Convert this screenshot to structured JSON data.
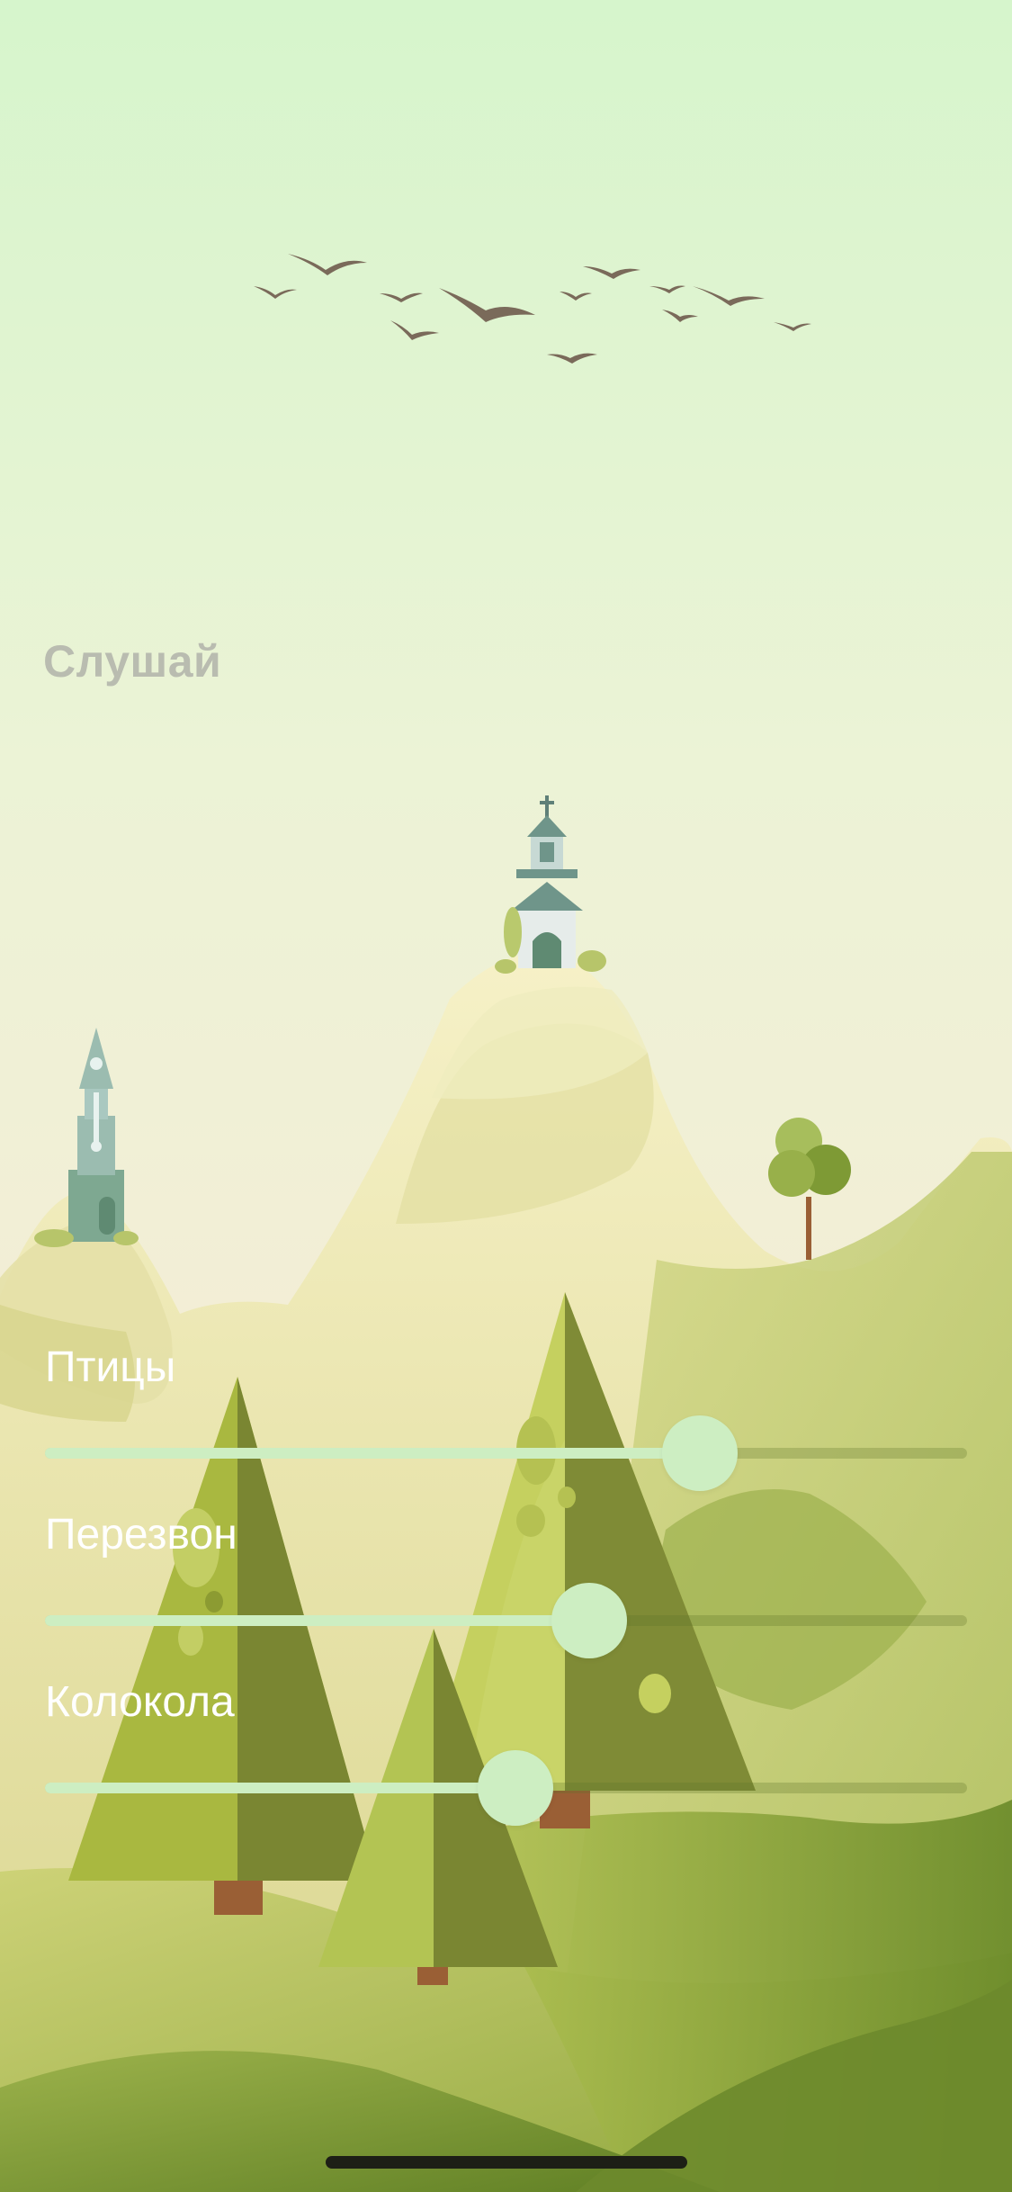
{
  "screen": {
    "title": "Слушай"
  },
  "sounds": [
    {
      "label": "Птицы",
      "level": 0.71
    },
    {
      "label": "Перезвон",
      "level": 0.59
    },
    {
      "label": "Колокола",
      "level": 0.51
    }
  ],
  "colors": {
    "sky_top": "#d6f5cc",
    "sky_bottom": "#f3eed6",
    "slider_fill": "#cdeec2",
    "title_gray": "#b9bcb0",
    "bird": "#7a6a5a"
  }
}
